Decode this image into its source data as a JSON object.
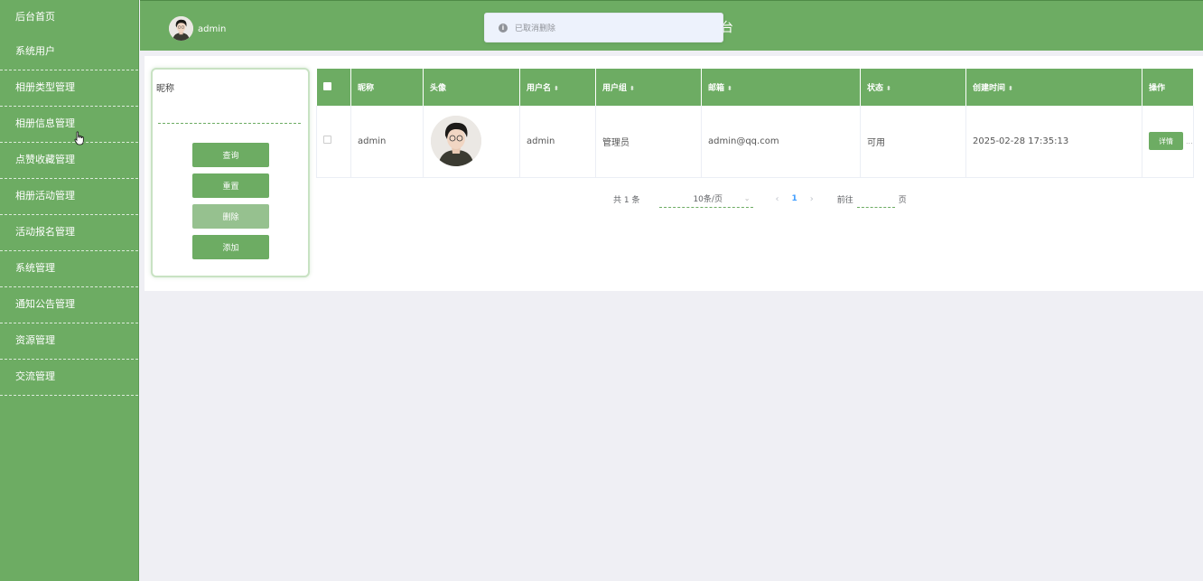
{
  "sidebar": {
    "items": [
      {
        "label": "后台首页"
      },
      {
        "label": "系统用户"
      },
      {
        "label": "相册类型管理"
      },
      {
        "label": "相册信息管理"
      },
      {
        "label": "点赞收藏管理"
      },
      {
        "label": "相册活动管理"
      },
      {
        "label": "活动报名管理"
      },
      {
        "label": "系统管理"
      },
      {
        "label": "通知公告管理"
      },
      {
        "label": "资源管理"
      },
      {
        "label": "交流管理"
      }
    ]
  },
  "header": {
    "username": "admin",
    "title_fragment": "台"
  },
  "toast": {
    "icon": "info-icon",
    "message": "已取消删除"
  },
  "search": {
    "label": "昵称",
    "value": "",
    "placeholder": "",
    "buttons": {
      "query": "查询",
      "reset": "重置",
      "delete": "删除",
      "add": "添加"
    }
  },
  "table": {
    "columns": [
      "昵称",
      "头像",
      "用户名",
      "用户组",
      "邮箱",
      "状态",
      "创建时间",
      "操作"
    ],
    "sortable": [
      "用户名",
      "用户组",
      "邮箱",
      "状态",
      "创建时间"
    ],
    "rows": [
      {
        "nickname": "admin",
        "avatar": "avatar-photo",
        "username": "admin",
        "group": "管理员",
        "email": "admin@qq.com",
        "status": "可用",
        "created": "2025-02-28 17:35:13",
        "action": "详情",
        "more": "..."
      }
    ]
  },
  "pagination": {
    "total_text": "共 1 条",
    "page_size": "10条/页",
    "current_page": "1",
    "goto_prefix": "前往",
    "goto_suffix": "页",
    "goto_value": ""
  },
  "colors": {
    "primary": "#6dac63",
    "background": "#efeff4",
    "link": "#409eff"
  }
}
